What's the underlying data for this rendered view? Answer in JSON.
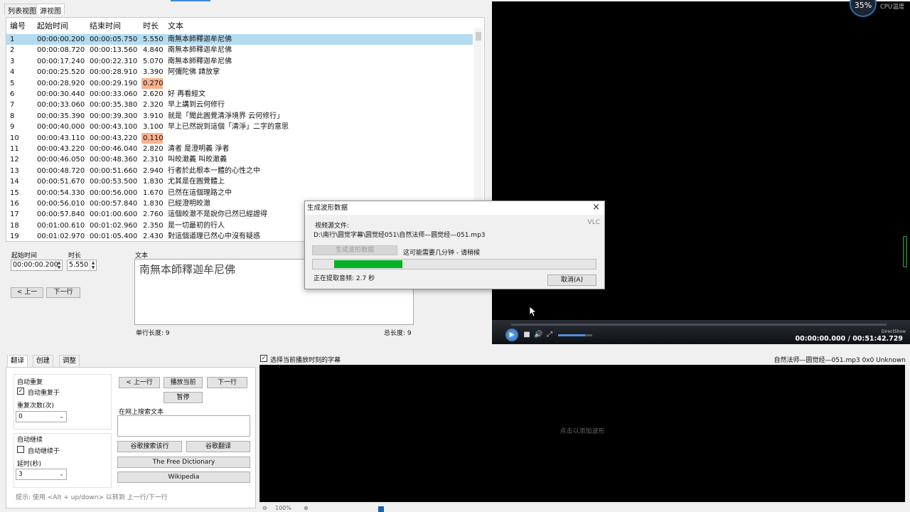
{
  "view_tabs": {
    "list": "列表视图",
    "source": "源视图"
  },
  "grid": {
    "headers": {
      "num": "编号",
      "start": "起始时间",
      "end": "结束时间",
      "dur": "时长",
      "text": "文本"
    },
    "rows": [
      {
        "num": "1",
        "start": "00:00:00.200",
        "end": "00:00:05.750",
        "dur": "5.550",
        "text": "南無本師釋迦牟尼佛",
        "selected": true
      },
      {
        "num": "2",
        "start": "00:00:08.720",
        "end": "00:00:13.560",
        "dur": "4.840",
        "text": "南無本師釋迦牟尼佛"
      },
      {
        "num": "3",
        "start": "00:00:17.240",
        "end": "00:00:22.310",
        "dur": "5.070",
        "text": "南無本師釋迦牟尼佛"
      },
      {
        "num": "4",
        "start": "00:00:25.520",
        "end": "00:00:28.910",
        "dur": "3.390",
        "text": "阿彌陀佛 請放掌"
      },
      {
        "num": "5",
        "start": "00:00:28.920",
        "end": "00:00:29.190",
        "dur": "0.270",
        "text": "",
        "warn": true
      },
      {
        "num": "6",
        "start": "00:00:30.440",
        "end": "00:00:33.060",
        "dur": "2.620",
        "text": "好 再看經文"
      },
      {
        "num": "7",
        "start": "00:00:33.060",
        "end": "00:00:35.380",
        "dur": "2.320",
        "text": "早上講到云何修行"
      },
      {
        "num": "8",
        "start": "00:00:35.390",
        "end": "00:00:39.300",
        "dur": "3.910",
        "text": "就是「聞此圓覺清淨境界 云何修行」"
      },
      {
        "num": "9",
        "start": "00:00:40.000",
        "end": "00:00:43.100",
        "dur": "3.100",
        "text": "早上已然說到這個「清淨」二字的意思"
      },
      {
        "num": "10",
        "start": "00:00:43.110",
        "end": "00:00:43.220",
        "dur": "0.110",
        "text": "",
        "warn": true
      },
      {
        "num": "11",
        "start": "00:00:43.220",
        "end": "00:00:46.040",
        "dur": "2.820",
        "text": "清者 是澄明義 淨者"
      },
      {
        "num": "12",
        "start": "00:00:46.050",
        "end": "00:00:48.360",
        "dur": "2.310",
        "text": "叫皎澈義 叫皎澈義"
      },
      {
        "num": "13",
        "start": "00:00:48.720",
        "end": "00:00:51.660",
        "dur": "2.940",
        "text": "行者於此根本一體的心性之中"
      },
      {
        "num": "14",
        "start": "00:00:51.670",
        "end": "00:00:53.500",
        "dur": "1.830",
        "text": "尤其是在圓覺體上"
      },
      {
        "num": "15",
        "start": "00:00:54.330",
        "end": "00:00:56.000",
        "dur": "1.670",
        "text": "已然在這個理路之中"
      },
      {
        "num": "16",
        "start": "00:00:56.010",
        "end": "00:00:57.840",
        "dur": "1.830",
        "text": "已經澄明皎澈"
      },
      {
        "num": "17",
        "start": "00:00:57.840",
        "end": "00:01:00.600",
        "dur": "2.760",
        "text": "這個皎澈不是說你已然已經證得"
      },
      {
        "num": "18",
        "start": "00:01:00.610",
        "end": "00:01:02.960",
        "dur": "2.350",
        "text": "是一切最初的行人"
      },
      {
        "num": "19",
        "start": "00:01:02.970",
        "end": "00:01:05.400",
        "dur": "2.430",
        "text": "對這個道理已然心中沒有疑惑"
      }
    ]
  },
  "editor": {
    "start_label": "起始时间",
    "start_value": "00:00:00.200",
    "dur_label": "时长",
    "dur_value": "5.550",
    "text_label": "文本",
    "text_value": "南無本師釋迦牟尼佛",
    "prev_btn": "< 上一",
    "next_btn": "下一行",
    "single_len": "单行长度: 9",
    "total_len": "总长度: 9"
  },
  "video": {
    "time": "00:00:00.000 / 00:51:42.729",
    "renderer": "DirectShow",
    "cpu_value": "35%",
    "cpu_label": "CPU温度"
  },
  "dialog": {
    "title": "生成波形数据",
    "source_label": "视频源文件:",
    "engine": "VLC",
    "path": "D:\\南行\\圆觉字幕\\圆觉经051\\自然法师—圆觉经—051.mp3",
    "gen_btn": "生成波形数据",
    "hint": "这可能需要几分钟 - 请稍候",
    "progress": 0.24,
    "status": "正在提取音频: 2.7 秒",
    "cancel_btn": "取消(A)",
    "close_icon": "×"
  },
  "bottom": {
    "tabs": [
      "翻译",
      "创建",
      "调整"
    ],
    "auto_repeat_group": "自动重复",
    "auto_repeat_on": "自动重复于",
    "repeat_count_label": "重复次数(次)",
    "repeat_count_value": "0",
    "auto_continue_group": "自动继续",
    "auto_continue_on": "自动继续于",
    "delay_label": "延时(秒)",
    "delay_value": "3",
    "prev_line": "< 上一行",
    "play_current": "播放当前",
    "next_line": "下一行",
    "pause": "暂停",
    "search_label": "在网上搜索文本",
    "google_search": "谷歌搜索该行",
    "google_translate": "谷歌翻译",
    "free_dict": "The Free Dictionary",
    "wikipedia": "Wikipedia",
    "tip": "提示: 使用 <Alt + up/down> 以转到 上一行/下一行"
  },
  "waveform": {
    "select_label": "选择当前播放时刻的字幕",
    "file_info": "自然法师—圆觉经—051.mp3 0x0 Unknown",
    "empty_hint": "点击以添加波形",
    "zoom": "100%"
  }
}
